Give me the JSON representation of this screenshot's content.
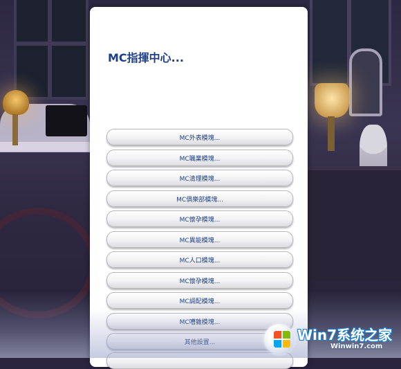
{
  "dialog": {
    "title": "MC指揮中心...",
    "buttons": [
      {
        "label": "MC外表模塊..."
      },
      {
        "label": "MC職業模塊..."
      },
      {
        "label": "MC清理模塊..."
      },
      {
        "label": "MC俱樂部模塊..."
      },
      {
        "label": "MC懷孕模塊..."
      },
      {
        "label": "MC異能模塊..."
      },
      {
        "label": "MC人口模塊..."
      },
      {
        "label": "MC懷孕模塊..."
      },
      {
        "label": "MC調配模塊..."
      },
      {
        "label": "MC嘈雜模塊..."
      },
      {
        "label": "其他設置..."
      },
      {
        "label": ""
      }
    ]
  },
  "watermark": {
    "brand": "Win7系统之家",
    "url": "Winwin7.com",
    "icon": "windows-logo-icon"
  },
  "colors": {
    "accent_text": "#1d3f8a",
    "panel_bg": "#ffffff"
  }
}
